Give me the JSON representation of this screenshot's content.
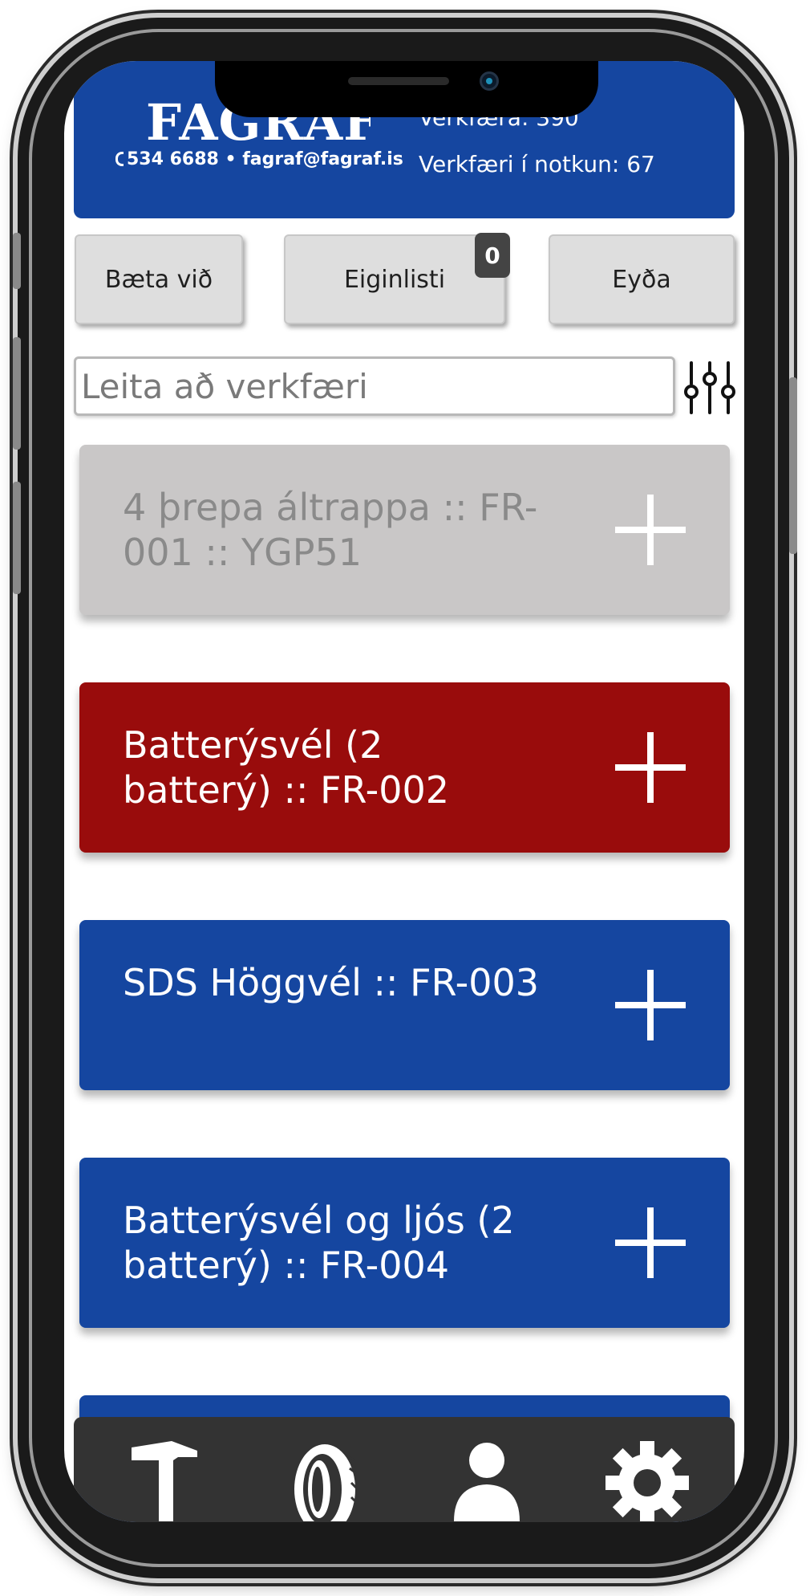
{
  "header": {
    "logo": "FAGRAF",
    "contact": "534 6688 • fagraf@fagraf.is",
    "total_tools_label": "Verkfæra: 390",
    "tools_in_use_label": "Verkfæri í notkun: 67"
  },
  "actions": {
    "add_label": "Bæta við",
    "own_list_label": "Eiginlisti",
    "own_list_count": "0",
    "delete_label": "Eyða"
  },
  "search": {
    "placeholder": "Leita að verkfæri",
    "value": ""
  },
  "tools": [
    {
      "name": "4 þrepa áltrappa :: FR-001 :: YGP51",
      "status": "unavailable",
      "color": "#c9c7c7",
      "text_color": "#8a8a8a"
    },
    {
      "name": "Batterýsvél (2 batterý) :: FR-002",
      "status": "in-use",
      "color": "#990c0c",
      "text_color": "#ffffff"
    },
    {
      "name": "SDS Höggvél :: FR-003",
      "status": "available",
      "color": "#1546a0",
      "text_color": "#ffffff"
    },
    {
      "name": "Batterýsvél og ljós (2 batterý) :: FR-004",
      "status": "available",
      "color": "#1546a0",
      "text_color": "#ffffff"
    },
    {
      "name": "",
      "status": "available",
      "color": "#1546a0",
      "text_color": "#ffffff"
    }
  ],
  "nav": {
    "items": [
      "hammer-icon",
      "tire-icon",
      "user-icon",
      "gear-icon"
    ]
  },
  "colors": {
    "brand_blue": "#1546a0",
    "in_use_red": "#990c0c",
    "unavailable_gray": "#c9c7c7",
    "nav_bg": "#333333"
  }
}
